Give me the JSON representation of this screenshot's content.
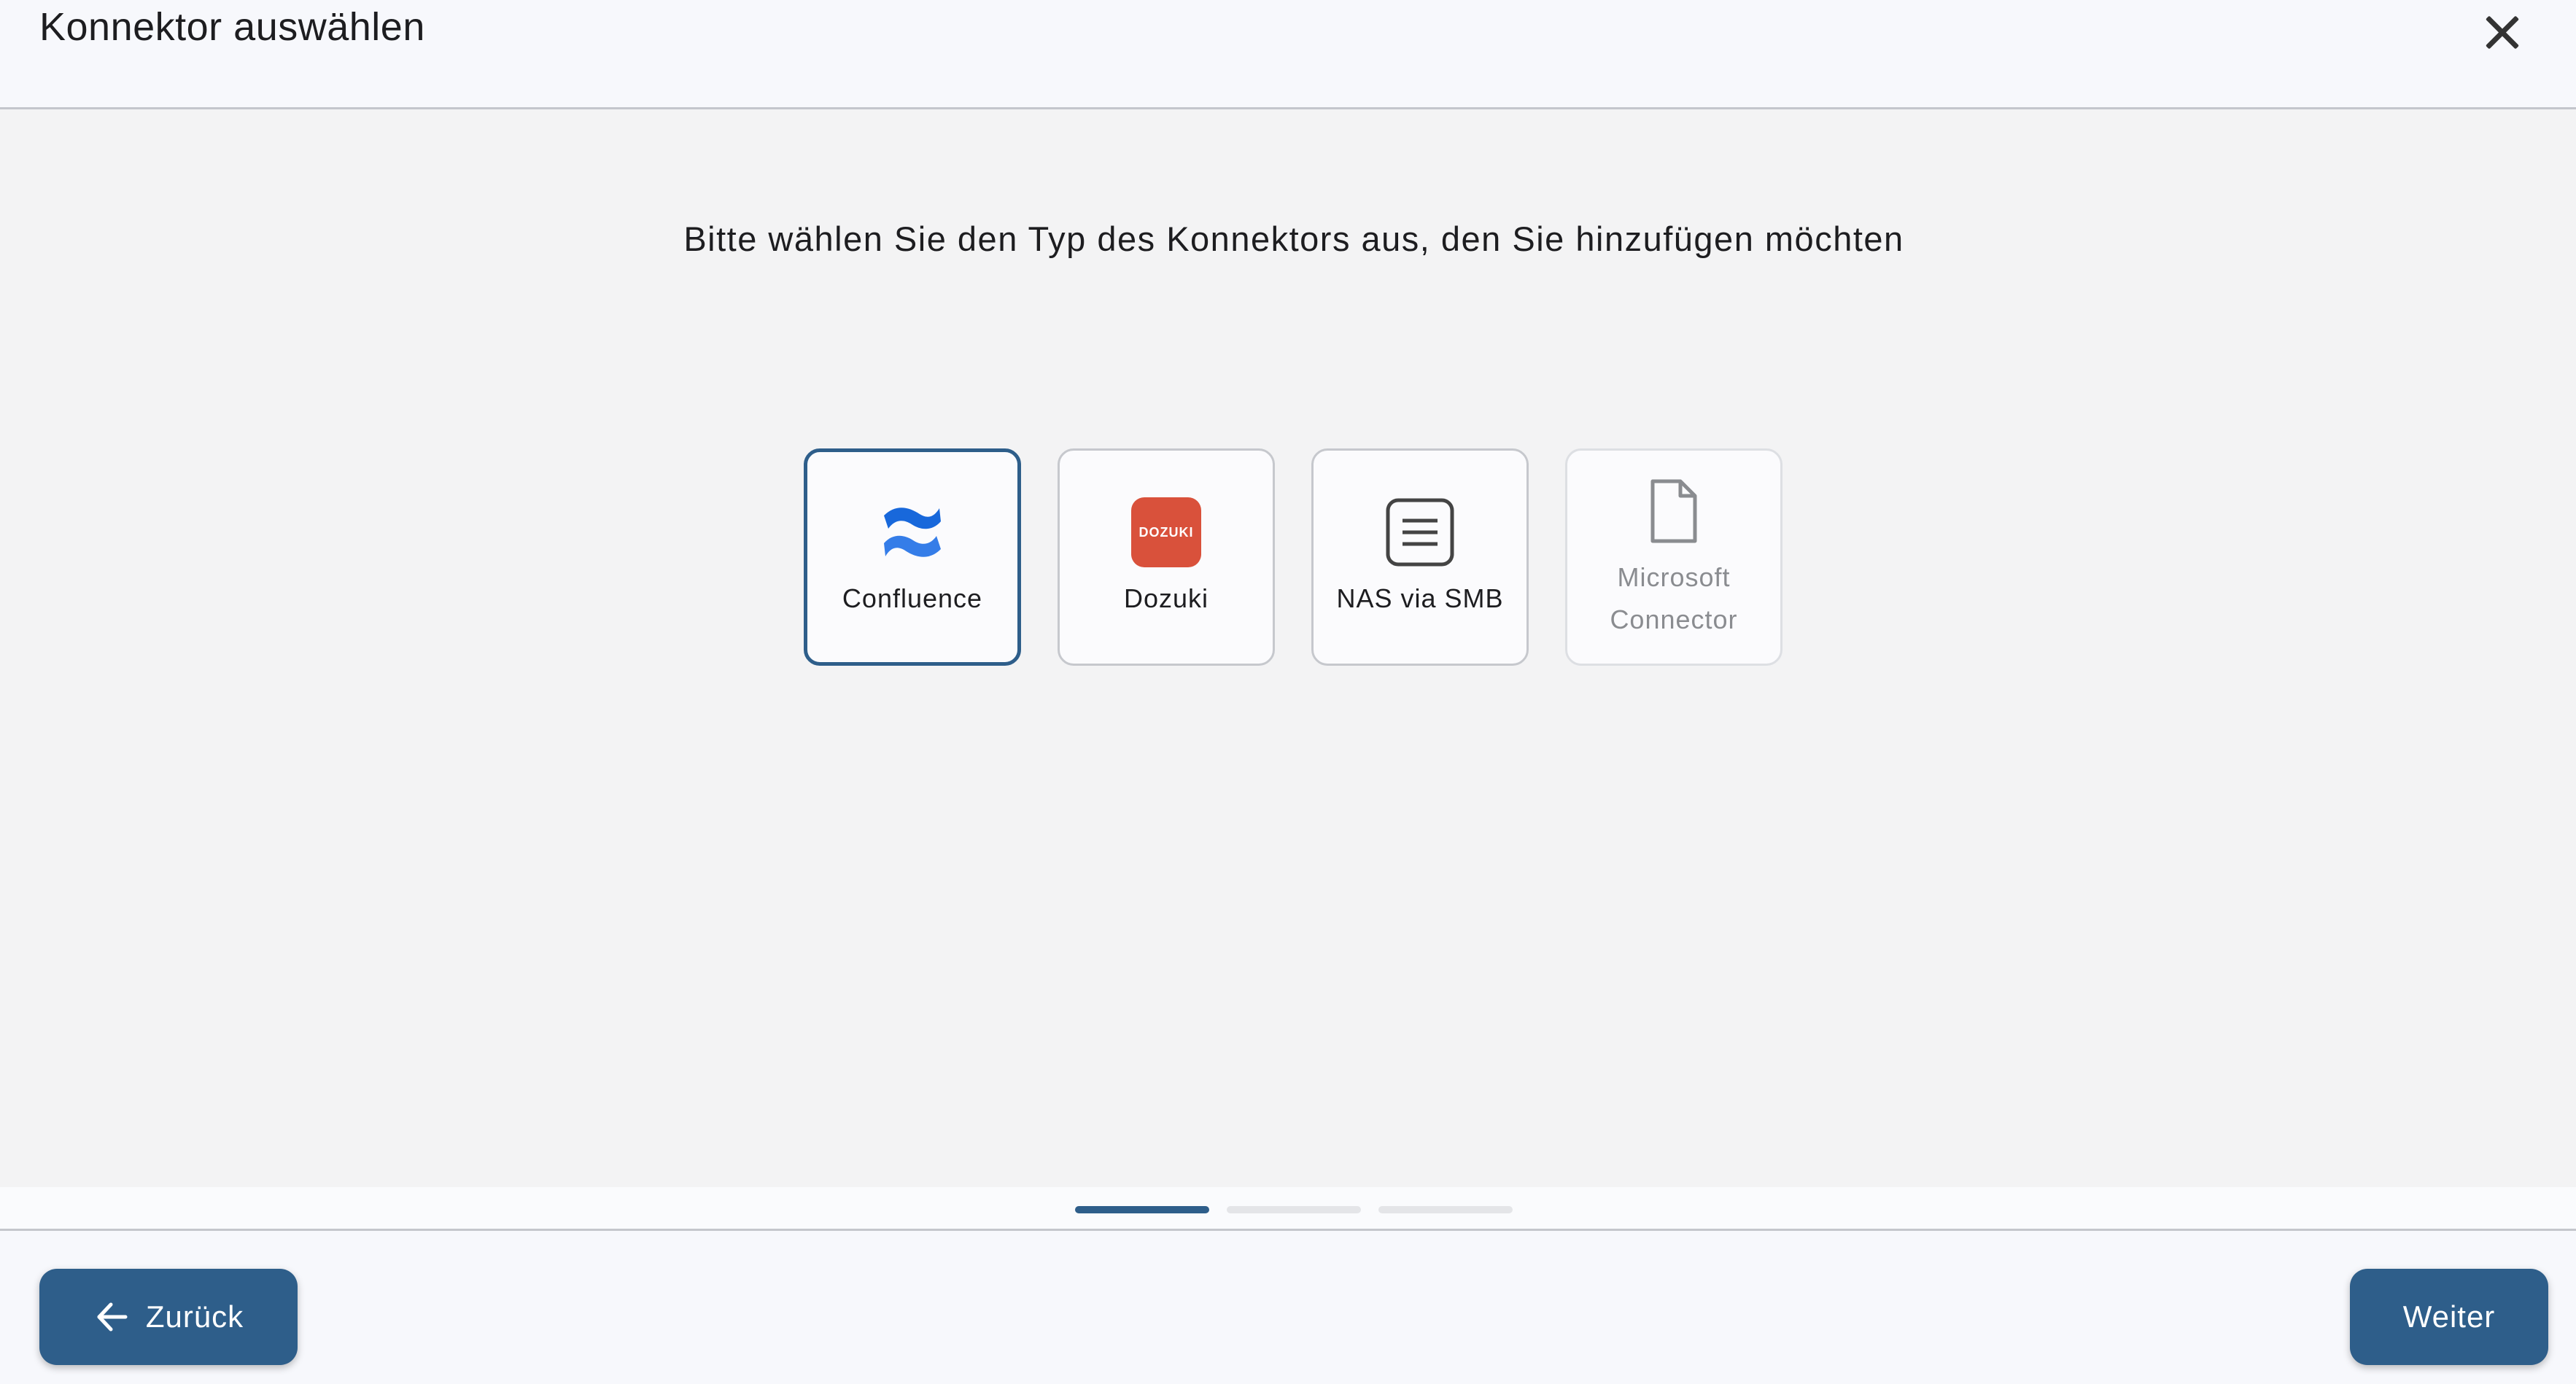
{
  "header": {
    "title": "Konnektor auswählen",
    "close_icon": "close-icon"
  },
  "main": {
    "prompt": "Bitte wählen Sie den Typ des Konnektors aus, den Sie hinzufügen möchten",
    "connectors": [
      {
        "label": "Confluence",
        "icon": "confluence-logo",
        "state": "selected"
      },
      {
        "label": "Dozuki",
        "icon": "dozuki-logo",
        "logo_text": "DOZUKI",
        "state": "available"
      },
      {
        "label": "NAS via SMB",
        "icon": "document-lines-icon",
        "state": "available"
      },
      {
        "label": "Microsoft Connector",
        "icon": "file-icon",
        "state": "disabled"
      }
    ]
  },
  "stepper": {
    "current_step": 1,
    "total_steps": 3
  },
  "footer": {
    "back_label": "Zurück",
    "back_icon": "arrow-left-icon",
    "next_label": "Weiter"
  },
  "colors": {
    "accent": "#2e5e8a",
    "dozuki": "#d9513b",
    "confluence": "#1868db"
  }
}
